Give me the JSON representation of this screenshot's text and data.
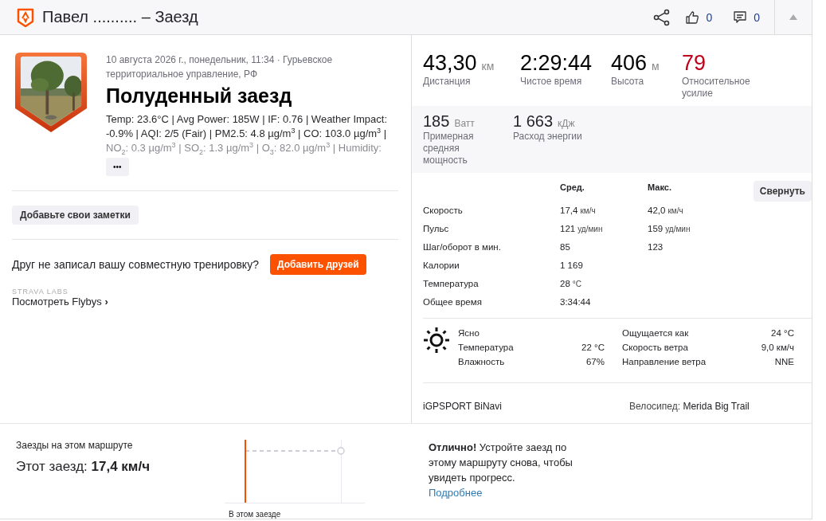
{
  "header": {
    "title": "Павел .......... – Заезд",
    "likes": "0",
    "comments": "0"
  },
  "activity": {
    "meta": "10 августа 2026 г., понедельник, 11:34 · Гурьевское территориальное управление, РФ",
    "title": "Полуденный заезд",
    "description": "Temp: 23.6°C | Avg Power: 185W | IF: 0.76 | Weather Impact: -0.9% | AQI: 2/5 (Fair) | PM2.5: 4.8 µg/m$^{3}$ | CO: 103.0 µg/m$^{3}$ | NO$_{2}$: 0.3 µg/m$^{3}$ | SO$_{2}$: 1.3 µg/m$^{3}$ | O$_{3}$: 82.0 µg/m$^{3}$ | Humidity:",
    "more_button": "•••"
  },
  "notes_button": "Добавьте свои заметки",
  "friends": {
    "text": "Друг не записал вашу совместную тренировку?",
    "button": "Добавить друзей"
  },
  "labs": {
    "caption": "STRAVA LABS",
    "link": "Посмотреть Flybys",
    "chevron": "›"
  },
  "main_stats": [
    {
      "value": "43,30",
      "unit": "км",
      "label": "Дистанция",
      "color": "#000000"
    },
    {
      "value": "2:29:44",
      "label": "Чистое время",
      "color": "#000000"
    },
    {
      "value": "406",
      "unit": "м",
      "label": "Высота",
      "color": "#000000"
    },
    {
      "value": "79",
      "label": "Относительное усилие",
      "color": "#c0001a"
    }
  ],
  "secondary_stats": [
    {
      "value": "185",
      "unit": "Ватт",
      "label": "Примерная средняя мощность"
    },
    {
      "value": "1 663",
      "unit": "кДж",
      "label": "Расход энергии"
    }
  ],
  "details": {
    "avg_header": "Сред.",
    "max_header": "Макс.",
    "collapse_button": "Свернуть",
    "rows": [
      {
        "label": "Скорость",
        "avg": "17,4",
        "avg_unit": "км/ч",
        "max": "42,0",
        "max_unit": "км/ч"
      },
      {
        "label": "Пульс",
        "avg": "121",
        "avg_unit": "уд/мин",
        "max": "159",
        "max_unit": "уд/мин"
      },
      {
        "label": "Шаг/оборот в мин.",
        "avg": "85",
        "max": "123"
      },
      {
        "label": "Калории",
        "avg": "1 169"
      },
      {
        "label": "Температура",
        "avg": "28",
        "avg_unit": "°C"
      },
      {
        "label": "Общее время",
        "avg": "3:34:44"
      }
    ]
  },
  "weather": {
    "condition": "Ясно",
    "left": [
      {
        "label": "Температура",
        "value": "22 °C"
      },
      {
        "label": "Влажность",
        "value": "67%"
      }
    ],
    "right": [
      {
        "label": "Ощущается как",
        "value": "24 °C"
      },
      {
        "label": "Скорость ветра",
        "value": "9,0 км/ч"
      },
      {
        "label": "Направление ветра",
        "value": "NNE"
      }
    ]
  },
  "device": "iGPSPORT BiNavi",
  "bike": {
    "label": "Велосипед:",
    "name": "Merida Big Trail"
  },
  "segment": {
    "title": "Заезды на этом маршруте",
    "result": "Этот заезд: **17,4 км/ч**",
    "chart_label": "В этом заезде",
    "message": "**Отлично!** Устройте заезд по этому маршруту снова, чтобы увидеть прогресс.",
    "more_link": "Подробнее"
  }
}
